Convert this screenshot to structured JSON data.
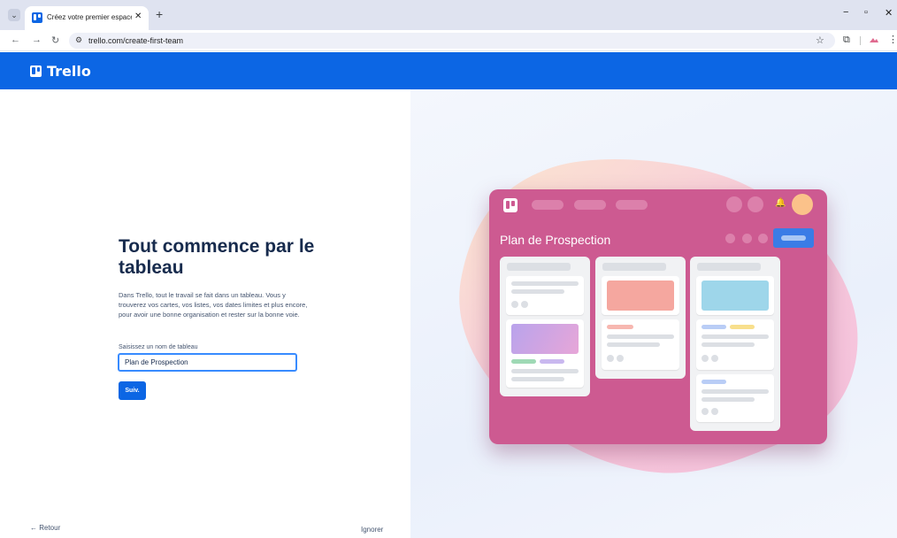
{
  "browser": {
    "tab_title": "Créez votre premier espace de travail",
    "tab_close": "✕",
    "new_tab": "+",
    "url": "trello.com/create-first-team",
    "controls": {
      "minimize": "−",
      "restore": "▫",
      "close": "✕"
    }
  },
  "header": {
    "logo_text": "Trello"
  },
  "main": {
    "headline": "Tout commence par le tableau",
    "description": "Dans Trello, tout le travail se fait dans un tableau. Vous y trouverez vos cartes, vos listes, vos dates limites et plus encore, pour avoir une bonne organisation et rester sur la bonne voie.",
    "field_label": "Saisissez un nom de tableau",
    "field_value": "Plan de Prospection",
    "next_label": "Suiv.",
    "back_label": "← Retour",
    "skip_label": "Ignorer"
  },
  "illustration": {
    "board_title": "Plan de Prospection",
    "board_color": "#cd5a91",
    "avatar_color": "#fbc28a"
  },
  "colors": {
    "brand": "#0c66e4",
    "focus": "#388bff"
  }
}
